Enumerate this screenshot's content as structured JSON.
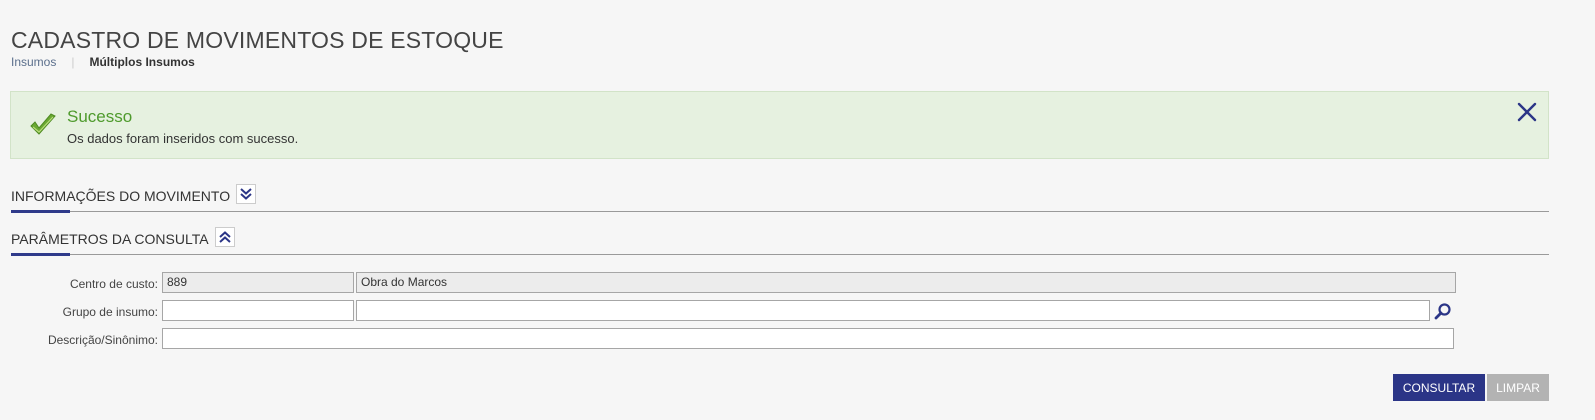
{
  "page": {
    "title": "CADASTRO DE MOVIMENTOS DE ESTOQUE"
  },
  "breadcrumb": {
    "items": [
      "Insumos",
      "Múltiplos Insumos"
    ],
    "separator": "|"
  },
  "alert": {
    "title": "Sucesso",
    "message": "Os dados foram inseridos com sucesso.",
    "icon": "check-icon",
    "color": "#4e9a2c"
  },
  "sections": {
    "movement_info": {
      "title": "INFORMAÇÕES DO MOVIMENTO",
      "toggle_icon": "chevron-double-down-icon"
    },
    "query_params": {
      "title": "PARÂMETROS DA CONSULTA",
      "toggle_icon": "chevron-double-up-icon"
    }
  },
  "form": {
    "cost_center": {
      "label": "Centro de custo:",
      "code": "889",
      "name": "Obra do Marcos"
    },
    "supply_group": {
      "label": "Grupo de insumo:",
      "code": "",
      "name": ""
    },
    "description": {
      "label": "Descrição/Sinônimo:",
      "value": ""
    }
  },
  "actions": {
    "consult_label": "CONSULTAR",
    "clear_label": "LIMPAR"
  },
  "colors": {
    "accent": "#2b3587",
    "success_bg": "#e6f1e0",
    "disabled": "#b3b3b3"
  }
}
